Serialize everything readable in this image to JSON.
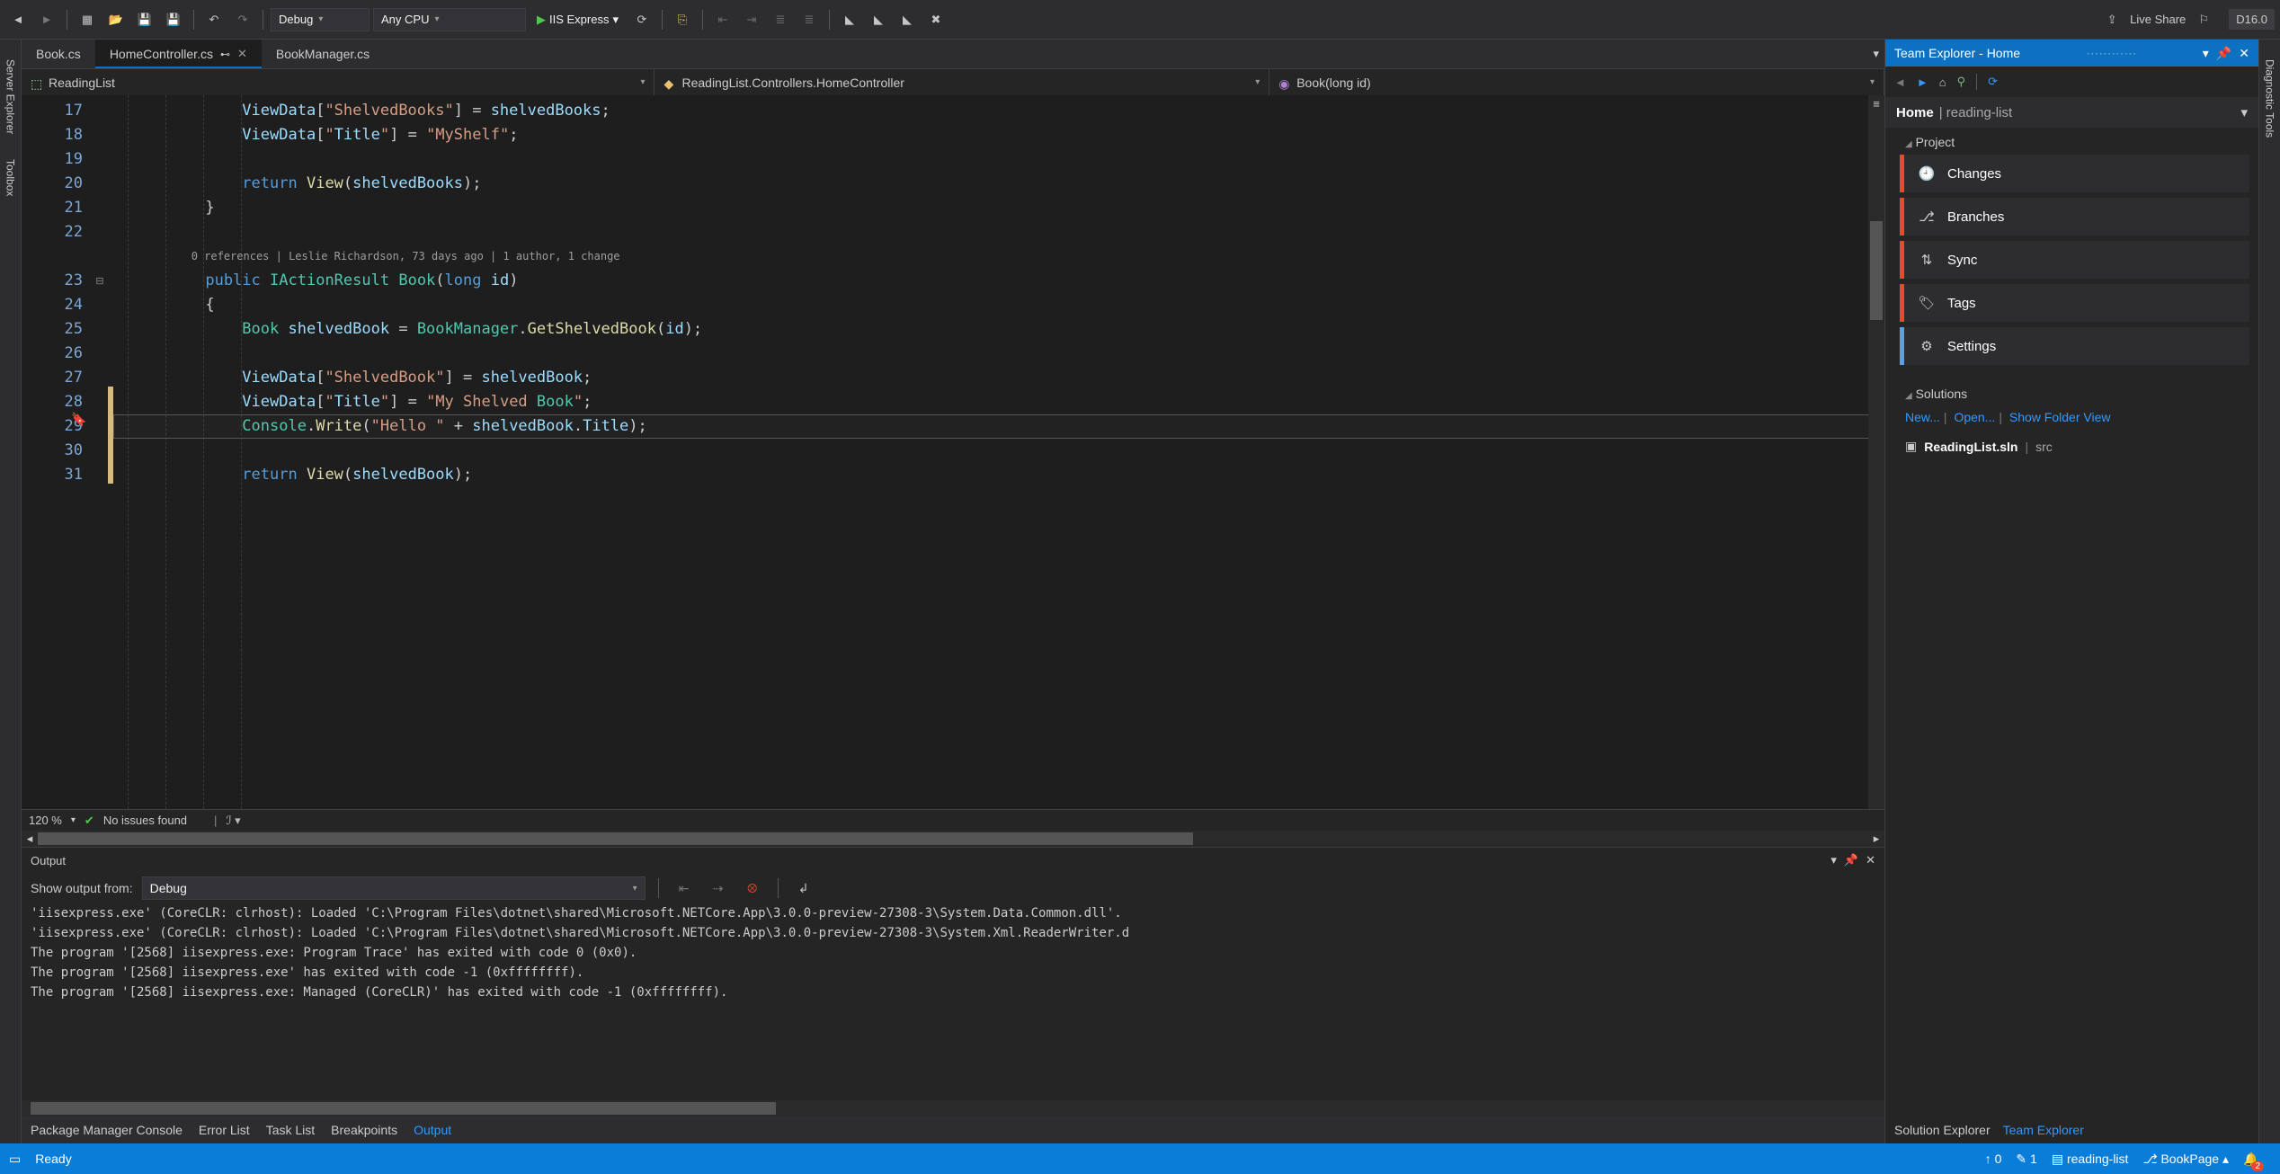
{
  "toolbar": {
    "config": "Debug",
    "platform": "Any CPU",
    "run_target": "IIS Express",
    "live_share": "Live Share",
    "version_badge": "D16.0"
  },
  "left_tabs": [
    "Server Explorer",
    "Toolbox"
  ],
  "right_tabs": [
    "Diagnostic Tools"
  ],
  "doc_tabs": [
    {
      "label": "Book.cs",
      "active": false,
      "pinned": false
    },
    {
      "label": "HomeController.cs",
      "active": true,
      "pinned": true
    },
    {
      "label": "BookManager.cs",
      "active": false,
      "pinned": false
    }
  ],
  "nav": {
    "project": "ReadingList",
    "type": "ReadingList.Controllers.HomeController",
    "member": "Book(long id)"
  },
  "code": {
    "first_line_no": 17,
    "line_numbers": [
      17,
      18,
      19,
      20,
      21,
      22,
      23,
      24,
      25,
      26,
      27,
      28,
      29,
      30,
      31
    ],
    "highlighted_line": 29,
    "codelens": "0 references | Leslie Richardson, 73 days ago | 1 author, 1 change",
    "lines_plain": [
      "        ViewData[\"ShelvedBooks\"] = shelvedBooks;",
      "        ViewData[\"Title\"] = \"MyShelf\";",
      "",
      "        return View(shelvedBooks);",
      "    }",
      "",
      "    public IActionResult Book(long id)",
      "    {",
      "        Book shelvedBook = BookManager.GetShelvedBook(id);",
      "",
      "        ViewData[\"ShelvedBook\"] = shelvedBook;",
      "        ViewData[\"Title\"] = \"My Shelved Book\";",
      "        Console.Write(\"Hello \" + shelvedBook.Title);",
      "",
      "        return View(shelvedBook);"
    ]
  },
  "editor_footer": {
    "zoom": "120 %",
    "status": "No issues found"
  },
  "output": {
    "title": "Output",
    "from_label": "Show output from:",
    "from_value": "Debug",
    "lines": [
      "'iisexpress.exe' (CoreCLR: clrhost): Loaded 'C:\\Program Files\\dotnet\\shared\\Microsoft.NETCore.App\\3.0.0-preview-27308-3\\System.Data.Common.dll'.",
      "'iisexpress.exe' (CoreCLR: clrhost): Loaded 'C:\\Program Files\\dotnet\\shared\\Microsoft.NETCore.App\\3.0.0-preview-27308-3\\System.Xml.ReaderWriter.d",
      "The program '[2568] iisexpress.exe: Program Trace' has exited with code 0 (0x0).",
      "The program '[2568] iisexpress.exe' has exited with code -1 (0xffffffff).",
      "The program '[2568] iisexpress.exe: Managed (CoreCLR)' has exited with code -1 (0xffffffff)."
    ]
  },
  "bottom_tabs": [
    "Package Manager Console",
    "Error List",
    "Task List",
    "Breakpoints",
    "Output"
  ],
  "bottom_active": "Output",
  "team_explorer": {
    "title": "Team Explorer - Home",
    "home_label": "Home",
    "context": "reading-list",
    "project_label": "Project",
    "items": [
      {
        "label": "Changes",
        "color": "orange",
        "icon": "clock"
      },
      {
        "label": "Branches",
        "color": "orange",
        "icon": "branch"
      },
      {
        "label": "Sync",
        "color": "orange",
        "icon": "sync"
      },
      {
        "label": "Tags",
        "color": "orange",
        "icon": "tag"
      },
      {
        "label": "Settings",
        "color": "blue",
        "icon": "gear"
      }
    ],
    "solutions_label": "Solutions",
    "links": [
      "New...",
      "Open...",
      "Show Folder View"
    ],
    "solution_name": "ReadingList.sln",
    "solution_sub": "src"
  },
  "te_footer_tabs": [
    "Solution Explorer",
    "Team Explorer"
  ],
  "te_footer_active": "Team Explorer",
  "status": {
    "ready": "Ready",
    "up": "0",
    "down": "1",
    "repo": "reading-list",
    "branch": "BookPage",
    "notifications": "2"
  }
}
